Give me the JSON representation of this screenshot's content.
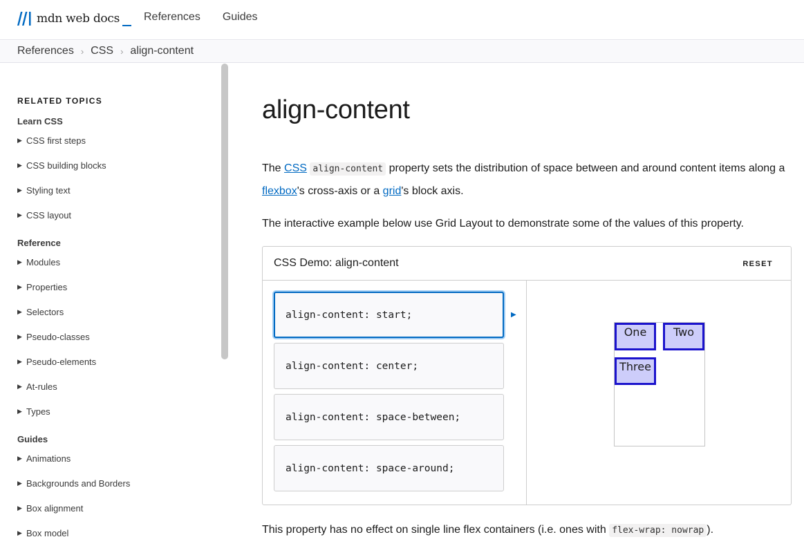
{
  "header": {
    "logo_text": "mdn web docs",
    "nav": [
      "References",
      "Guides"
    ]
  },
  "breadcrumb": [
    "References",
    "CSS",
    "align-content"
  ],
  "sidebar": {
    "heading": "RELATED TOPICS",
    "groups": [
      {
        "title": "Learn CSS",
        "items": [
          "CSS first steps",
          "CSS building blocks",
          "Styling text",
          "CSS layout"
        ]
      },
      {
        "title": "Reference",
        "items": [
          "Modules",
          "Properties",
          "Selectors",
          "Pseudo-classes",
          "Pseudo-elements",
          "At-rules",
          "Types"
        ]
      },
      {
        "title": "Guides",
        "items": [
          "Animations",
          "Backgrounds and Borders",
          "Box alignment",
          "Box model"
        ]
      }
    ]
  },
  "main": {
    "title": "align-content",
    "intro": {
      "t1": "The ",
      "link_css": "CSS",
      "code": "align-content",
      "t2": " property sets the distribution of space between and around content items along a ",
      "link_flexbox": "flexbox",
      "t3": "'s cross-axis or a ",
      "link_grid": "grid",
      "t4": "'s block axis."
    },
    "para2": "The interactive example below use Grid Layout to demonstrate some of the values of this property.",
    "demo": {
      "title": "CSS Demo: align-content",
      "reset": "RESET",
      "choices": [
        "align-content: start;",
        "align-content: center;",
        "align-content: space-between;",
        "align-content: space-around;"
      ],
      "selected_index": 0,
      "cells": [
        "One",
        "Two",
        "Three"
      ]
    },
    "para3": {
      "t1": "This property has no effect on single line flex containers (i.e. ones with ",
      "code": "flex-wrap: nowrap",
      "t2": ")."
    }
  },
  "colors": {
    "accent": "#0069c2",
    "cell_border": "#1a12cc",
    "cell_fill": "#cdcdfa"
  }
}
